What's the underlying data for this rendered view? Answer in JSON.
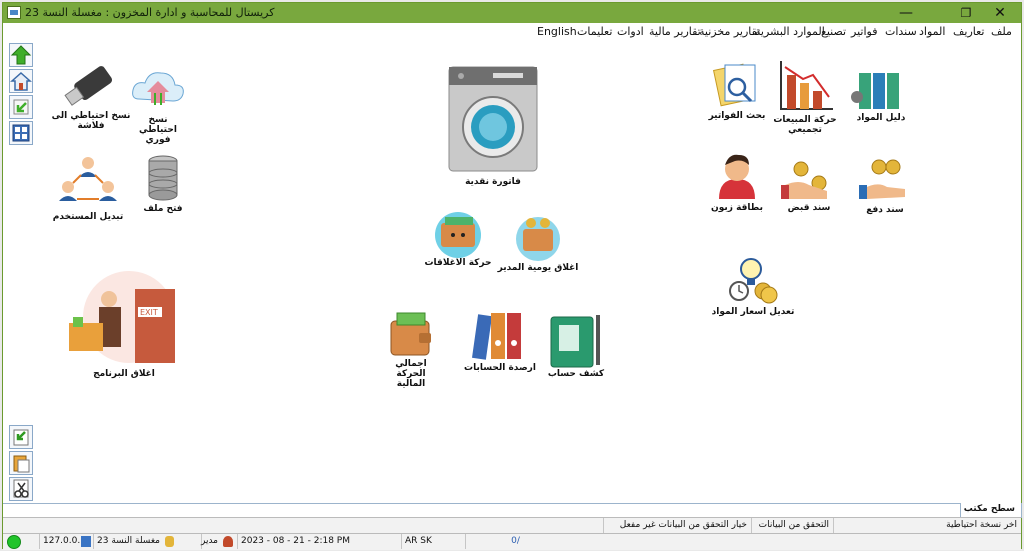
{
  "window": {
    "title": "كريستال للمحاسبة و ادارة المخزون : مغسلة النسة 23"
  },
  "menu": [
    "ملف",
    "تعاريف",
    "المواد",
    "سندات",
    "فواتير",
    "تصنيع",
    "الموارد البشرية",
    "تقارير مخزنية",
    "تقارير مالية",
    "ادوات",
    "تعليمات",
    "English"
  ],
  "tiles": {
    "backup_flash": "نسخ احتياطي الى فلاشة",
    "backup_instant": "نسخ احتياطي فوري",
    "switch_user": "تبديل المستخدم",
    "open_file": "فتح ملف",
    "close_program": "اغلاق البرنامج",
    "cash_invoice": "فاتورة نقدية",
    "closings_movement": "حركة الاغلاقات",
    "close_manager_daily": "اغلاق يومية المدير",
    "total_financial": "اجمالي الحركة المالية",
    "account_balances": "ارصدة الحسابات",
    "account_statement": "كشف حساب",
    "search_invoices": "بحث الفواتير",
    "sales_summary": "حركة المبيعات تجميعي",
    "materials_guide": "دليل المواد",
    "customer_card": "بطاقة زبون",
    "receipt_voucher": "سند قبض",
    "payment_voucher": "سند دفع",
    "edit_prices": "تعديل اسعار المواد"
  },
  "desktop_tab": "سطح مكتب",
  "status": {
    "last_backup": "اخر نسخة احتياطية",
    "data_check": "التحقق من البيانات",
    "data_check_option": "خيار التحقق من البيانات غير مفعل"
  },
  "status2": {
    "ip": "127.0.0.1",
    "company": "مغسلة النسة 23",
    "user": "مدير",
    "datetime": "2023 - 08 - 21  -  2:18 PM",
    "lang": "AR  SK",
    "page": "0/"
  },
  "colors": {
    "titlebar": "#79a83e",
    "status_ok": "#21c42a"
  }
}
